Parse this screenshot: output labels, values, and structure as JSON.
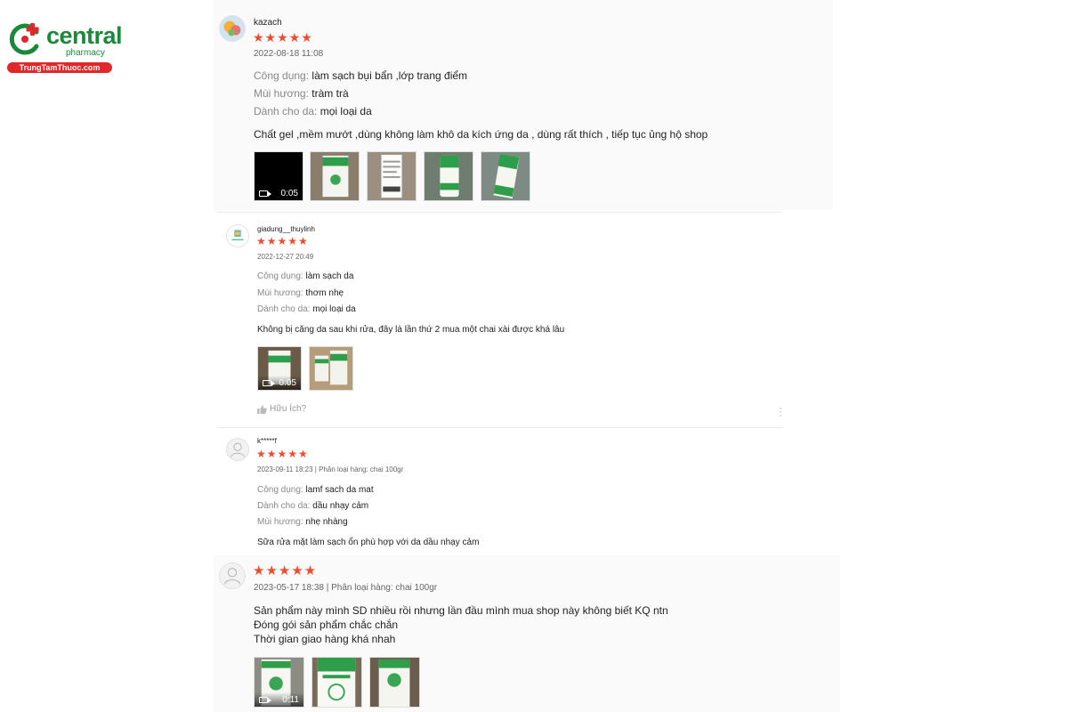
{
  "brand": {
    "name": "central",
    "sub": "pharmacy",
    "tagline": "TrungTamThuoc.com",
    "colors": {
      "green": "#1a8a3a",
      "red": "#e0282a",
      "star": "#ee4d2d"
    }
  },
  "reviews": [
    {
      "username": "kazach",
      "stars": "★★★★★",
      "meta": "2022-08-18 11:08",
      "attributes": [
        {
          "key": "Công dụng:",
          "value": "làm sạch bụi bẩn ,lớp trang điểm"
        },
        {
          "key": "Mùi hương:",
          "value": "tràm trà"
        },
        {
          "key": "Dành cho da:",
          "value": "mọi loại da"
        }
      ],
      "comment": "Chất gel ,mềm mướt ,dùng không làm khô da kích ứng da , dùng rất thích , tiếp tục ủng hộ shop",
      "video_duration": "0:05"
    },
    {
      "username": "giadung__thuylinh",
      "stars": "★★★★★",
      "meta": "2022-12-27 20:49",
      "attributes": [
        {
          "key": "Công dụng:",
          "value": "làm sạch da"
        },
        {
          "key": "Mùi hương:",
          "value": "thơm nhẹ"
        },
        {
          "key": "Dành cho da:",
          "value": "mọi loại da"
        }
      ],
      "comment": "Không bị căng da sau khi rửa, đây là lần thứ 2 mua một chai xài được khá lâu",
      "video_duration": "0:05",
      "helpful_label": "Hữu Ích?"
    },
    {
      "username": "k*****f",
      "stars": "★★★★★",
      "meta": "2023-09-11 18:23 | Phân loại hàng: chai 100gr",
      "attributes": [
        {
          "key": "Công dụng:",
          "value": "lamf sach da mat"
        },
        {
          "key": "Dành cho da:",
          "value": "dầu nhạy cảm"
        },
        {
          "key": "Mùi hương:",
          "value": "nhẹ nhàng"
        }
      ],
      "comment": "Sữa rửa mặt làm sạch ổn phù hợp với da dầu nhạy cảm"
    },
    {
      "stars": "★★★★★",
      "meta": "2023-05-17 18:38 | Phân loại hàng: chai 100gr",
      "comment_lines": [
        "Sản phẩm này mình SD nhiều rồi nhưng lần đầu mình mua shop này không biết KQ ntn",
        "Đóng gói sản phẩm chắc chắn",
        "Thời gian giao hàng khá nhah"
      ],
      "video_duration": "0:11"
    }
  ]
}
